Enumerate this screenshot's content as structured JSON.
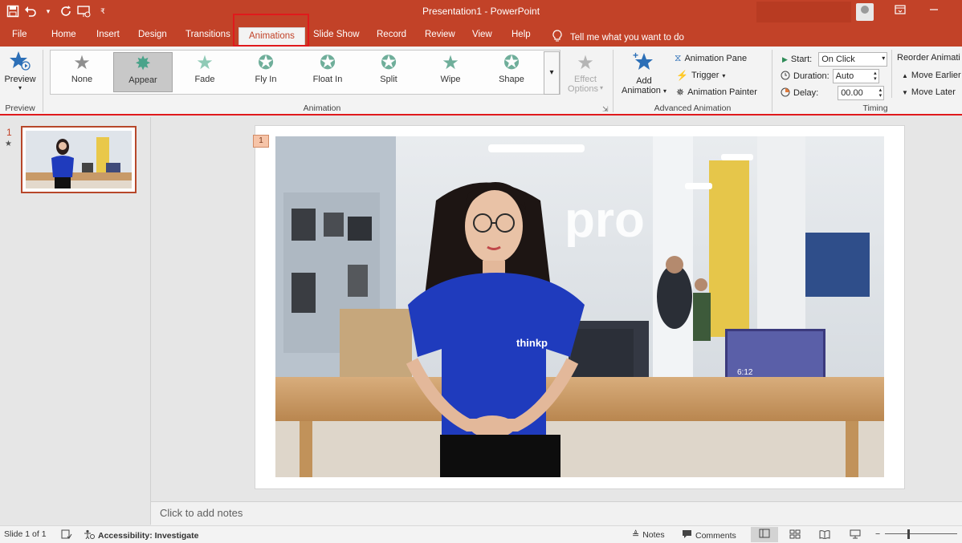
{
  "window": {
    "title": "Presentation1  -  PowerPoint"
  },
  "qat": {
    "save_icon": "save-icon",
    "undo_icon": "undo-icon",
    "redo_icon": "redo-icon",
    "present_icon": "present-from-start-icon",
    "customize_icon": "customize-qat-icon"
  },
  "tabs": [
    "File",
    "Home",
    "Insert",
    "Design",
    "Transitions",
    "Animations",
    "Slide Show",
    "Record",
    "Review",
    "View",
    "Help"
  ],
  "active_tab": "Animations",
  "tellme": {
    "placeholder": "Tell me what you want to do"
  },
  "ribbon": {
    "preview": {
      "label": "Preview",
      "group": "Preview"
    },
    "animation_group": "Animation",
    "animations": [
      {
        "label": "None",
        "selected": false
      },
      {
        "label": "Appear",
        "selected": true
      },
      {
        "label": "Fade",
        "selected": false
      },
      {
        "label": "Fly In",
        "selected": false
      },
      {
        "label": "Float In",
        "selected": false
      },
      {
        "label": "Split",
        "selected": false
      },
      {
        "label": "Wipe",
        "selected": false
      },
      {
        "label": "Shape",
        "selected": false
      }
    ],
    "effect_options": {
      "line1": "Effect",
      "line2": "Options"
    },
    "advanced": {
      "group": "Advanced Animation",
      "add_animation_1": "Add",
      "add_animation_2": "Animation",
      "animation_pane": "Animation Pane",
      "trigger": "Trigger",
      "animation_painter": "Animation Painter"
    },
    "timing": {
      "group": "Timing",
      "start_label": "Start:",
      "start_value": "On Click",
      "duration_label": "Duration:",
      "duration_value": "Auto",
      "delay_label": "Delay:",
      "delay_value": "00.00",
      "reorder_label": "Reorder Animati",
      "move_earlier": "Move Earlier",
      "move_later": "Move Later"
    }
  },
  "slides": {
    "current_number": "1",
    "animation_tag": "1"
  },
  "notes": {
    "placeholder": "Click to add notes"
  },
  "status": {
    "slide_info": "Slide 1 of 1",
    "accessibility": "Accessibility: Investigate",
    "notes_btn": "Notes",
    "comments_btn": "Comments"
  },
  "colors": {
    "accent": "#c24228",
    "highlight_border": "#e0191c",
    "shirt": "#1f3bbd"
  }
}
